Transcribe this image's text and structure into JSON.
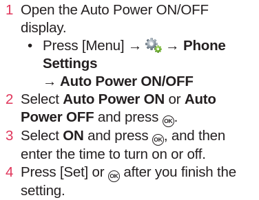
{
  "steps": [
    {
      "num": "1",
      "text": "Open the Auto Power ON/OFF display.",
      "sub": {
        "bullet": "•",
        "prefix": "Press [Menu] →",
        "arrow": "→",
        "phone_settings": "Phone Settings",
        "auto_power": "→ Auto Power ON/OFF"
      }
    },
    {
      "num": "2",
      "pre": "Select",
      "on": "Auto Power ON",
      "or": "or",
      "off": "Auto Power OFF",
      "post": "and press",
      "end": "."
    },
    {
      "num": "3",
      "pre": "Select",
      "on": "ON",
      "mid": "and press",
      "post": ", and then enter the time to turn on or off."
    },
    {
      "num": "4",
      "pre": "Press [Set] or",
      "post": "after you finish the setting."
    }
  ],
  "icons": {
    "ok_label": "OK",
    "gear": "settings-gear-icon"
  },
  "colors": {
    "step_number": "#e0365b",
    "text": "#231f20"
  }
}
